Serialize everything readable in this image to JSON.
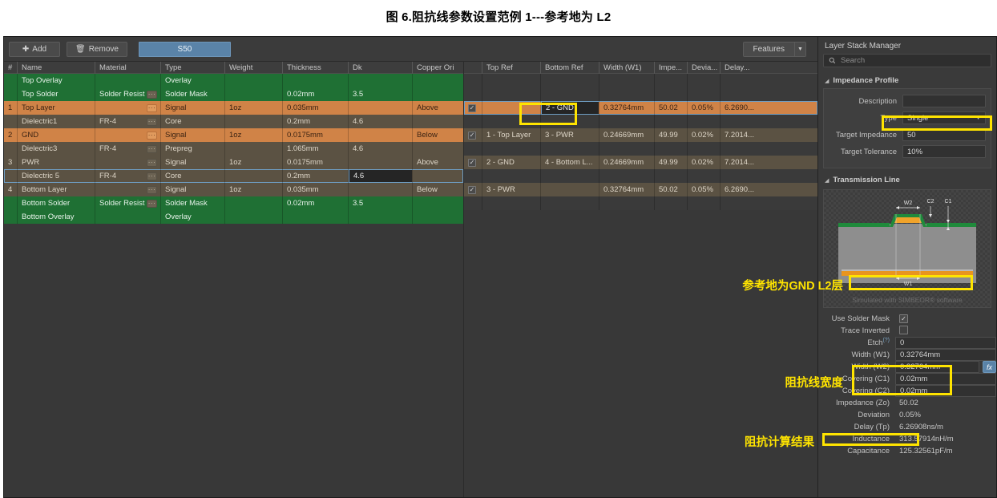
{
  "caption": "图 6.阻抗线参数设置范例 1---参考地为 L2",
  "toolbar": {
    "add_label": "Add",
    "add_icon": "plus-icon",
    "remove_label": "Remove",
    "remove_icon": "trash-icon",
    "tab_label": "S50",
    "features_label": "Features",
    "features_caret": "▼"
  },
  "stack_table": {
    "columns": [
      "#",
      "Name",
      "Material",
      "Type",
      "Weight",
      "Thickness",
      "Dk",
      "Copper Ori"
    ],
    "rows": [
      {
        "num": "",
        "name": "Top Overlay",
        "material": "",
        "type": "Overlay",
        "weight": "",
        "thickness": "",
        "dk": "",
        "orient": "",
        "style": "r-overlay",
        "dots": false
      },
      {
        "num": "",
        "name": "Top Solder",
        "material": "Solder Resist",
        "type": "Solder Mask",
        "weight": "",
        "thickness": "0.02mm",
        "dk": "3.5",
        "orient": "",
        "style": "r-solder",
        "dots": true,
        "dots_style": "on-die"
      },
      {
        "num": "1",
        "name": "Top Layer",
        "material": "",
        "type": "Signal",
        "weight": "1oz",
        "thickness": "0.035mm",
        "dk": "",
        "orient": "Above",
        "style": "r-signal",
        "dots": true,
        "dots_style": "on-sig"
      },
      {
        "num": "",
        "name": "Dielectric1",
        "material": "FR-4",
        "type": "Core",
        "weight": "",
        "thickness": "0.2mm",
        "dk": "4.6",
        "orient": "",
        "style": "r-diel",
        "dots": true,
        "dots_style": "on-die"
      },
      {
        "num": "2",
        "name": "GND",
        "material": "",
        "type": "Signal",
        "weight": "1oz",
        "thickness": "0.0175mm",
        "dk": "",
        "orient": "Below",
        "style": "r-signal",
        "dots": true,
        "dots_style": "on-sig"
      },
      {
        "num": "",
        "name": "Dielectric3",
        "material": "FR-4",
        "type": "Prepreg",
        "weight": "",
        "thickness": "1.065mm",
        "dk": "4.6",
        "orient": "",
        "style": "r-diel",
        "dots": true,
        "dots_style": "on-die"
      },
      {
        "num": "3",
        "name": "PWR",
        "material": "",
        "type": "Signal",
        "weight": "1oz",
        "thickness": "0.0175mm",
        "dk": "",
        "orient": "Above",
        "style": "r-diel",
        "dots": true,
        "dots_style": "on-die"
      },
      {
        "num": "",
        "name": "Dielectric 5",
        "material": "FR-4",
        "type": "Core",
        "weight": "",
        "thickness": "0.2mm",
        "dk": "4.6",
        "orient": "",
        "style": "r-diel",
        "dots": true,
        "dots_style": "on-die",
        "selected": true,
        "dk_editing": true
      },
      {
        "num": "4",
        "name": "Bottom Layer",
        "material": "",
        "type": "Signal",
        "weight": "1oz",
        "thickness": "0.035mm",
        "dk": "",
        "orient": "Below",
        "style": "r-diel",
        "dots": true,
        "dots_style": "on-die"
      },
      {
        "num": "",
        "name": "Bottom Solder",
        "material": "Solder Resist",
        "type": "Solder Mask",
        "weight": "",
        "thickness": "0.02mm",
        "dk": "3.5",
        "orient": "",
        "style": "r-solder",
        "dots": true,
        "dots_style": "on-die"
      },
      {
        "num": "",
        "name": "Bottom Overlay",
        "material": "",
        "type": "Overlay",
        "weight": "",
        "thickness": "",
        "dk": "",
        "orient": "",
        "style": "r-overlay",
        "dots": false
      }
    ]
  },
  "impedance_table": {
    "columns": [
      "",
      "Top Ref",
      "Bottom Ref",
      "Width (W1)",
      "Impe...",
      "Devia...",
      "Delay..."
    ],
    "rows": [
      {
        "checked": null,
        "top_ref": "",
        "bottom_ref": "",
        "width": "",
        "impedance": "",
        "deviation": "",
        "delay": "",
        "style": "blank"
      },
      {
        "checked": null,
        "top_ref": "",
        "bottom_ref": "",
        "width": "",
        "impedance": "",
        "deviation": "",
        "delay": "",
        "style": "blank"
      },
      {
        "checked": true,
        "top_ref": "",
        "bottom_ref": "2 - GND",
        "width": "0.32764mm",
        "impedance": "50.02",
        "deviation": "0.05%",
        "delay": "6.2690...",
        "style": "r-signal",
        "selected": true,
        "bottom_ref_editing": true
      },
      {
        "checked": null,
        "top_ref": "",
        "bottom_ref": "",
        "width": "",
        "impedance": "",
        "deviation": "",
        "delay": "",
        "style": "blank"
      },
      {
        "checked": true,
        "top_ref": "1 - Top Layer",
        "bottom_ref": "3 - PWR",
        "width": "0.24669mm",
        "impedance": "49.99",
        "deviation": "0.02%",
        "delay": "7.2014...",
        "style": "r-diel"
      },
      {
        "checked": null,
        "top_ref": "",
        "bottom_ref": "",
        "width": "",
        "impedance": "",
        "deviation": "",
        "delay": "",
        "style": "blank"
      },
      {
        "checked": true,
        "top_ref": "2 - GND",
        "bottom_ref": "4 - Bottom L...",
        "width": "0.24669mm",
        "impedance": "49.99",
        "deviation": "0.02%",
        "delay": "7.2014...",
        "style": "r-diel"
      },
      {
        "checked": null,
        "top_ref": "",
        "bottom_ref": "",
        "width": "",
        "impedance": "",
        "deviation": "",
        "delay": "",
        "style": "blank"
      },
      {
        "checked": true,
        "top_ref": "3 - PWR",
        "bottom_ref": "",
        "width": "0.32764mm",
        "impedance": "50.02",
        "deviation": "0.05%",
        "delay": "6.2690...",
        "style": "r-diel"
      },
      {
        "checked": null,
        "top_ref": "",
        "bottom_ref": "",
        "width": "",
        "impedance": "",
        "deviation": "",
        "delay": "",
        "style": "blank"
      }
    ]
  },
  "panel": {
    "title": "Layer Stack Manager",
    "search_placeholder": "Search",
    "search_icon": "search-icon",
    "impedance_profile": {
      "header": "Impedance Profile",
      "description_label": "Description",
      "description_value": "",
      "type_label": "Type",
      "type_value": "Single",
      "target_impedance_label": "Target Impedance",
      "target_impedance_value": "50",
      "target_tolerance_label": "Target Tolerance",
      "target_tolerance_value": "10%"
    },
    "transmission_line": {
      "header": "Transmission Line",
      "diagram_labels": {
        "w2": "W2",
        "c2": "C2",
        "c1": "C1",
        "w1": "W1"
      },
      "sim_note": "Simulated with SIMBEOR® software",
      "properties": [
        {
          "label": "Use Solder Mask",
          "value": "",
          "kind": "checkbox",
          "checked": true
        },
        {
          "label": "Trace Inverted",
          "value": "",
          "kind": "checkbox",
          "checked": false
        },
        {
          "label": "Etch",
          "value": "0",
          "kind": "field",
          "help": "?"
        },
        {
          "label": "Width (W1)",
          "value": "0.32764mm",
          "kind": "field"
        },
        {
          "label": "Width (W2)",
          "value": "0.32764mm",
          "kind": "field",
          "fx": "fx"
        },
        {
          "label": "Covering (C1)",
          "value": "0.02mm",
          "kind": "field"
        },
        {
          "label": "Covering (C2)",
          "value": "0.02mm",
          "kind": "field"
        },
        {
          "label": "Impedance (Zo)",
          "value": "50.02",
          "kind": "readonly"
        },
        {
          "label": "Deviation",
          "value": "0.05%",
          "kind": "readonly"
        },
        {
          "label": "Delay (Tp)",
          "value": "6.26908ns/m",
          "kind": "readonly"
        },
        {
          "label": "Inductance",
          "value": "313.57914nH/m",
          "kind": "readonly"
        },
        {
          "label": "Capacitance",
          "value": "125.32561pF/m",
          "kind": "readonly"
        }
      ]
    }
  },
  "annotations": {
    "ref_ground": "参考地为GND L2层",
    "trace_width": "阻抗线宽度",
    "impedance_result": "阻抗计算结果",
    "highlight_color": "#ffe400"
  }
}
